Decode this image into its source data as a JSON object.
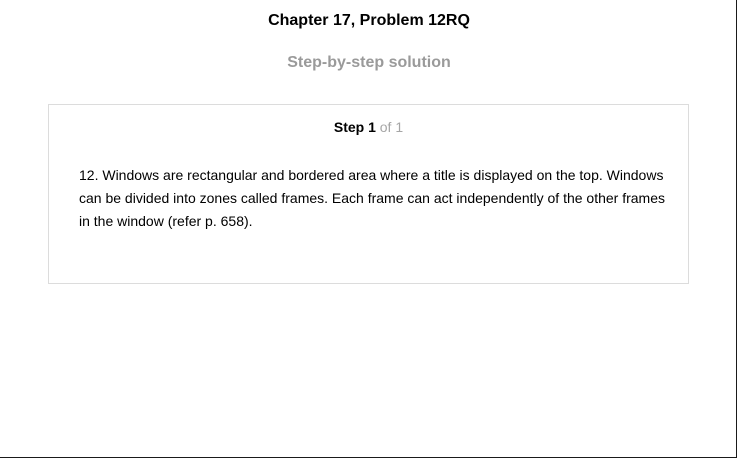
{
  "header": {
    "title": "Chapter 17, Problem 12RQ",
    "subtitle": "Step-by-step solution"
  },
  "step": {
    "label": "Step 1",
    "total": "of 1",
    "text": "12. Windows are rectangular and bordered area where a title is displayed on the top. Windows can be divided into zones called frames. Each frame can act independently of the other frames in the window (refer p. 658)."
  }
}
